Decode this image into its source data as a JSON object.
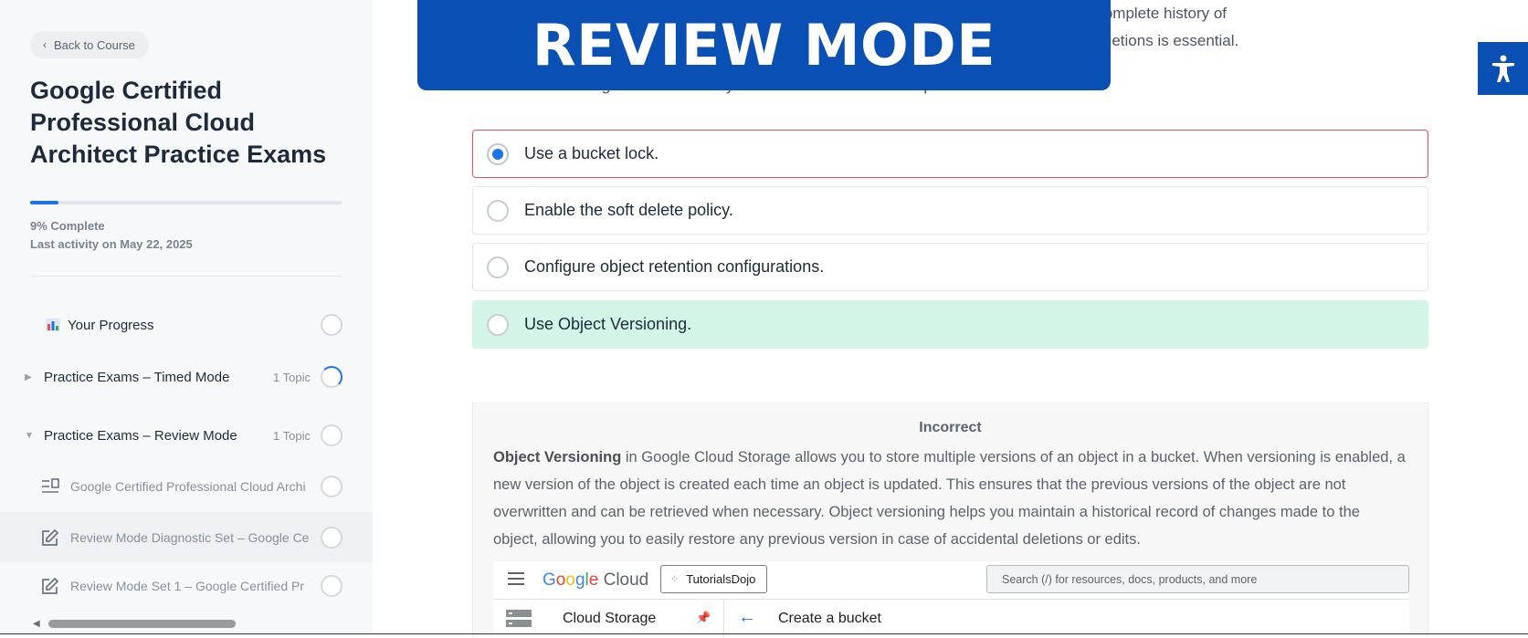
{
  "sidebar": {
    "back_label": "Back to Course",
    "course_title": "Google Certified Professional Cloud Architect Practice Exams",
    "progress_percent": 9,
    "progress_text": "9% Complete",
    "last_activity": "Last activity on May 22, 2025",
    "items": [
      {
        "label": "Your Progress",
        "icon": "chart-icon"
      },
      {
        "label": "Practice Exams – Timed Mode",
        "topics": "1 Topic",
        "state": "in-progress",
        "collapsed": true
      },
      {
        "label": "Practice Exams – Review Mode",
        "topics": "1 Topic",
        "state": "not-started",
        "collapsed": false
      },
      {
        "label": "Google Certified Professional Cloud Archi",
        "icon": "topic-list-icon"
      },
      {
        "label": "Review Mode Diagnostic Set – Google Ce",
        "icon": "edit-icon"
      },
      {
        "label": "Review Mode Set 1 – Google Certified Pr",
        "icon": "edit-icon"
      }
    ]
  },
  "banner": {
    "text": "REVIEW MODE"
  },
  "question": {
    "text_fragment_1": "ference. A complete history of",
    "text_fragment_2": "d edits or deletions is essential.",
    "prompt": "Which Cloud Storage feature should you enable to meet these requirements?",
    "answers": [
      {
        "label": "Use a bucket lock.",
        "selected": true,
        "status": "incorrect"
      },
      {
        "label": "Enable the soft delete policy.",
        "selected": false,
        "status": ""
      },
      {
        "label": "Configure object retention configurations.",
        "selected": false,
        "status": ""
      },
      {
        "label": "Use Object Versioning.",
        "selected": false,
        "status": "correct"
      }
    ]
  },
  "explanation": {
    "heading": "Incorrect",
    "bold_term": "Object Versioning",
    "body": " in Google Cloud Storage allows you to store multiple versions of an object in a bucket. When versioning is enabled, a new version of the object is created each time an object is updated. This ensures that the previous versions of the object are not overwritten and can be retrieved when necessary. Object versioning helps you maintain a historical record of changes made to the object, allowing you to easily restore any previous version in case of accidental deletions or edits."
  },
  "gcloud_screenshot": {
    "logo_google": "Google",
    "logo_cloud": "Cloud",
    "project": "TutorialsDojo",
    "search_placeholder": "Search (/) for resources, docs, products, and more",
    "product": "Cloud Storage",
    "page_title": "Create a bucket"
  },
  "colors": {
    "accent": "#1a73e8",
    "banner": "#0a4fb3",
    "correct_bg": "#d3f5e8",
    "incorrect_border": "#e8505b"
  }
}
